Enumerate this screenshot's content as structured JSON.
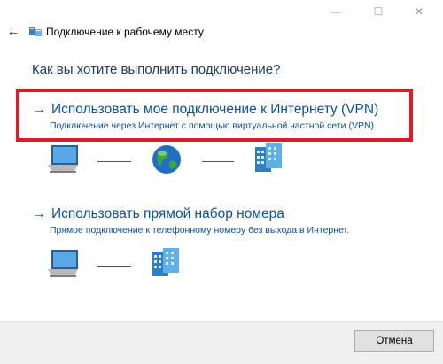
{
  "window": {
    "minimize_glyph": "—",
    "maximize_glyph": "☐",
    "close_glyph": "✕"
  },
  "nav": {
    "back_glyph": "←",
    "title": "Подключение к рабочему месту"
  },
  "heading": "Как вы хотите выполнить подключение?",
  "options": [
    {
      "arrow": "→",
      "title": "Использовать мое подключение к Интернету (VPN)",
      "description": "Подключение через Интернет с помощью виртуальной частной сети (VPN).",
      "highlighted": true
    },
    {
      "arrow": "→",
      "title": "Использовать прямой набор номера",
      "description": "Прямое подключение к телефонному номеру без выхода в Интернет.",
      "highlighted": false
    }
  ],
  "footer": {
    "cancel_label": "Отмена"
  },
  "colors": {
    "link": "#0a4fa8",
    "highlight_border": "#e01a24",
    "footer_bg": "#f0f0f0"
  },
  "icons": [
    "network-icon",
    "computer-icon",
    "globe-icon",
    "server-icon"
  ]
}
